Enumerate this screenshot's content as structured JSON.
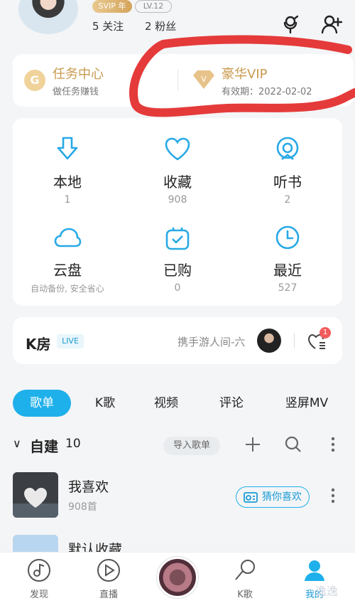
{
  "profile": {
    "badge_svip": "SVIP 年",
    "badge_level": "LV.12",
    "follow_text": "5 关注",
    "fans_text": "2 粉丝"
  },
  "task_center": {
    "icon_letter": "G",
    "title": "任务中心",
    "subtitle": "做任务赚钱"
  },
  "vip": {
    "title": "豪华VIP",
    "subtitle": "有效期：2022-02-02"
  },
  "grid": [
    {
      "label": "本地",
      "count": "1"
    },
    {
      "label": "收藏",
      "count": "908"
    },
    {
      "label": "听书",
      "count": "2"
    },
    {
      "label": "云盘",
      "count": "自动备份, 安全省心"
    },
    {
      "label": "已购",
      "count": "0"
    },
    {
      "label": "最近",
      "count": "527"
    }
  ],
  "k_room": {
    "title": "K房",
    "live": "LIVE",
    "host": "携手游人间-六",
    "notif_count": "1"
  },
  "tabs": [
    "歌单",
    "K歌",
    "视频",
    "评论",
    "竖屏MV"
  ],
  "section": {
    "chevron": "∨",
    "title": "自建",
    "count": "10",
    "import_label": "导入歌单"
  },
  "playlists": [
    {
      "name": "我喜欢",
      "sub": "908首",
      "guess_label": "猜你喜欢"
    },
    {
      "name": "默认收藏",
      "sub": ""
    }
  ],
  "bottom_nav": [
    {
      "label": "发现"
    },
    {
      "label": "直播"
    },
    {
      "label": "K歌"
    },
    {
      "label": "我的"
    }
  ],
  "colors": {
    "accent": "#1eb0ea",
    "gold": "#c89a4e",
    "scribble": "#e53a3a"
  },
  "watermark": "逸逸"
}
